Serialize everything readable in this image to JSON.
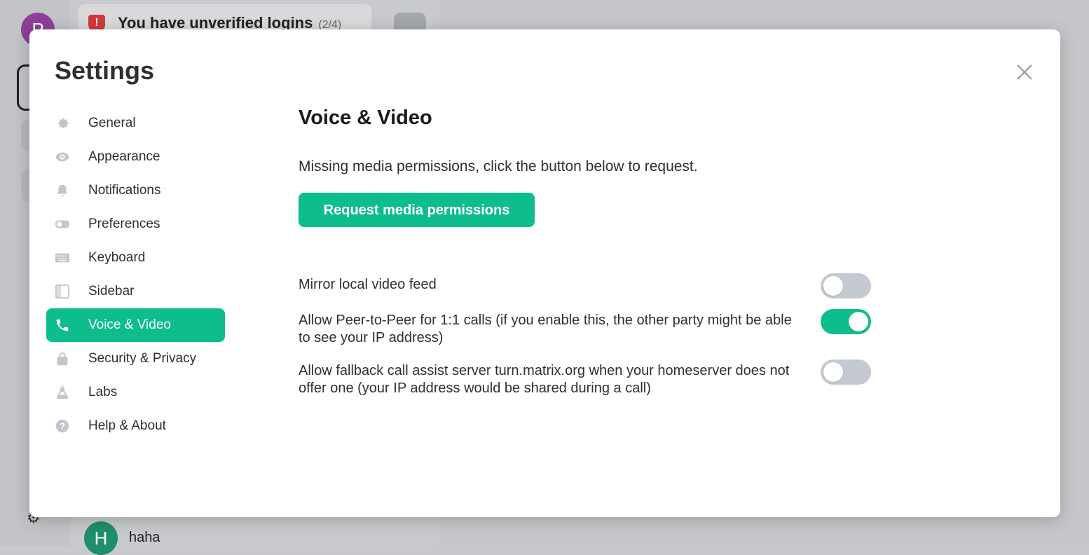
{
  "background": {
    "avatar_letter": "P",
    "notice_text": "You have unverified logins",
    "notice_count": "(2/4)",
    "room_avatar_letter": "H",
    "room_name": "haha"
  },
  "dialog": {
    "title": "Settings"
  },
  "nav": {
    "items": [
      {
        "label": "General",
        "icon": "gear-icon"
      },
      {
        "label": "Appearance",
        "icon": "eye-icon"
      },
      {
        "label": "Notifications",
        "icon": "bell-icon"
      },
      {
        "label": "Preferences",
        "icon": "toggle-icon"
      },
      {
        "label": "Keyboard",
        "icon": "keyboard-icon"
      },
      {
        "label": "Sidebar",
        "icon": "sidebar-icon"
      },
      {
        "label": "Voice & Video",
        "icon": "phone-icon",
        "active": true
      },
      {
        "label": "Security & Privacy",
        "icon": "lock-icon"
      },
      {
        "label": "Labs",
        "icon": "flask-icon"
      },
      {
        "label": "Help & About",
        "icon": "help-icon"
      }
    ]
  },
  "content": {
    "title": "Voice & Video",
    "permission_text": "Missing media permissions, click the button below to request.",
    "request_button": "Request media permissions",
    "settings": [
      {
        "label": "Mirror local video feed",
        "enabled": false
      },
      {
        "label": "Allow Peer-to-Peer for 1:1 calls (if you enable this, the other party might be able to see your IP address)",
        "enabled": true
      },
      {
        "label": "Allow fallback call assist server turn.matrix.org when your homeserver does not offer one (your IP address would be shared during a call)",
        "enabled": false
      }
    ]
  },
  "colors": {
    "accent": "#0dbd8b",
    "toggle_off": "#c4c9d2",
    "text": "#2e2f32"
  }
}
